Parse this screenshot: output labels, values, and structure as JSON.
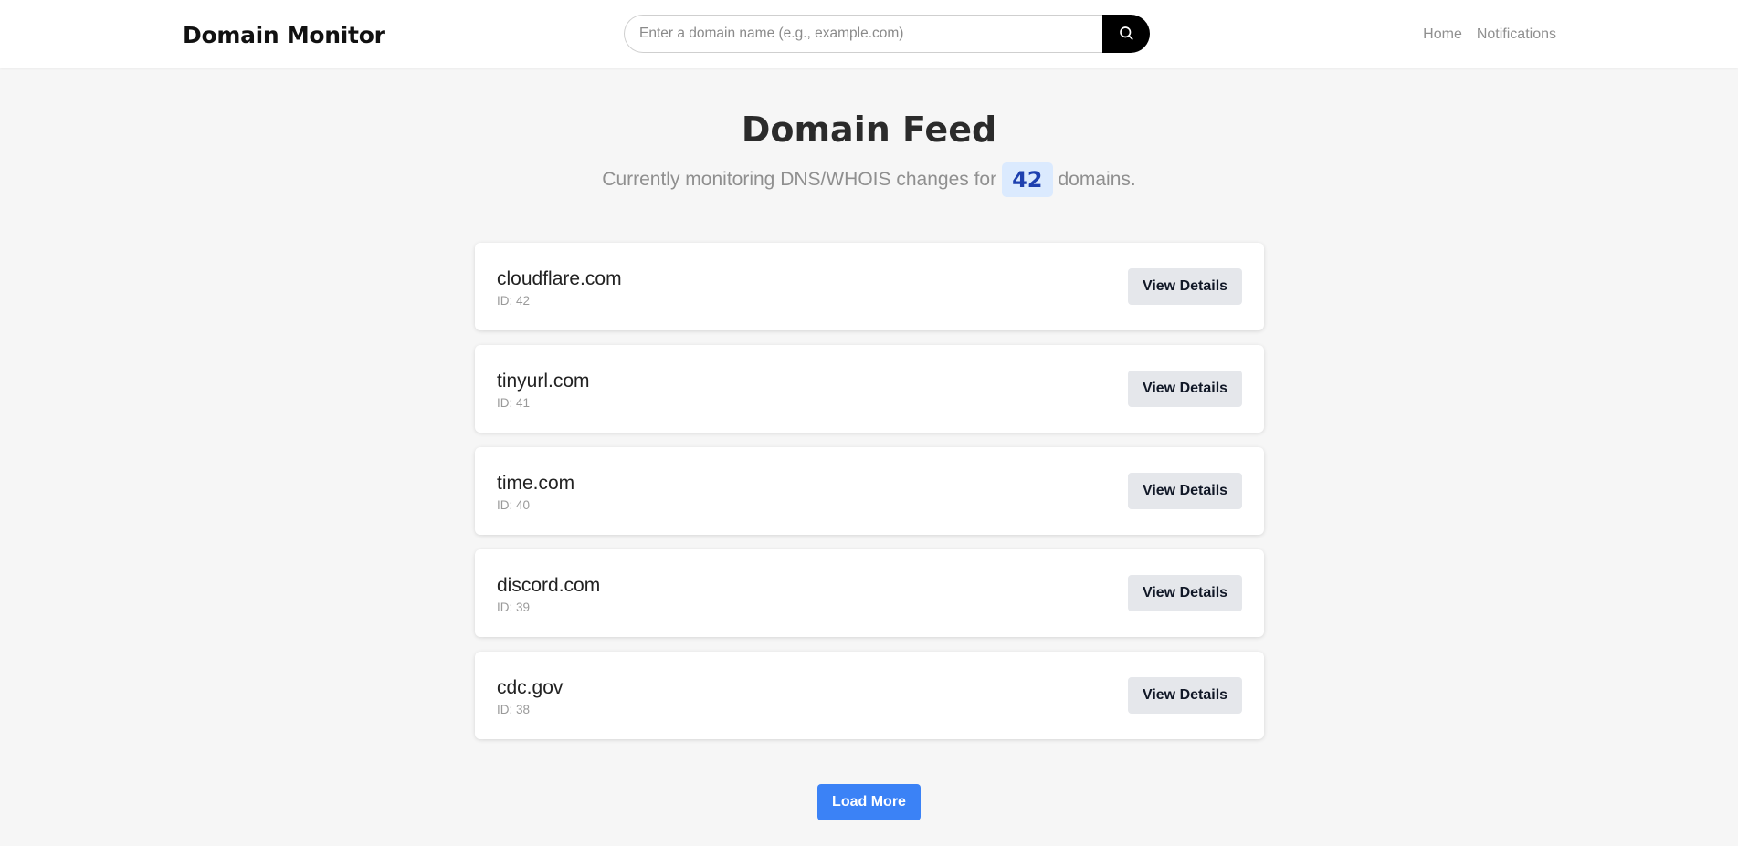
{
  "header": {
    "brand": "Domain Monitor",
    "search": {
      "placeholder": "Enter a domain name (e.g., example.com)",
      "value": "",
      "icon": "search-icon"
    },
    "nav": [
      {
        "label": "Home"
      },
      {
        "label": "Notifications"
      }
    ]
  },
  "main": {
    "title": "Domain Feed",
    "subtitle_prefix": "Currently monitoring DNS/WHOIS changes for",
    "count": "42",
    "subtitle_suffix": "domains.",
    "domains": [
      {
        "name": "cloudflare.com",
        "id": "ID: 42",
        "button": "View Details"
      },
      {
        "name": "tinyurl.com",
        "id": "ID: 41",
        "button": "View Details"
      },
      {
        "name": "time.com",
        "id": "ID: 40",
        "button": "View Details"
      },
      {
        "name": "discord.com",
        "id": "ID: 39",
        "button": "View Details"
      },
      {
        "name": "cdc.gov",
        "id": "ID: 38",
        "button": "View Details"
      }
    ],
    "load_more": "Load More"
  },
  "colors": {
    "accent": "#3b82f6",
    "badge_bg": "#dbeafe",
    "badge_text": "#1e40af",
    "background": "#f6f6f6"
  }
}
